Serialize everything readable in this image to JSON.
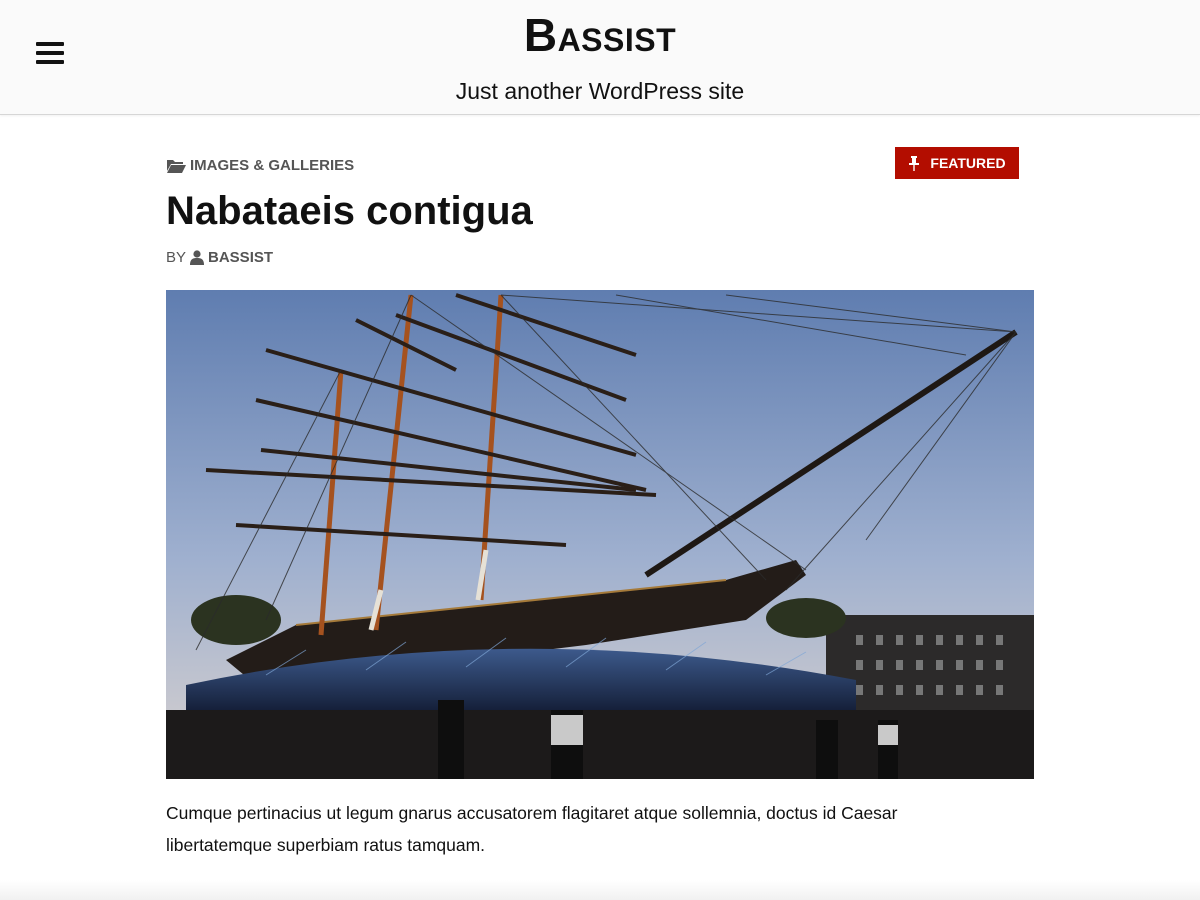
{
  "header": {
    "site_title": "Bassist",
    "site_description": "Just another WordPress site",
    "menu_icon": "hamburger-menu-icon"
  },
  "post": {
    "category": "Images & Galleries",
    "category_icon": "folder-open-icon",
    "featured_label": "Featured",
    "featured_icon": "pushpin-icon",
    "featured_color": "#b30d00",
    "title": "Nabataeis contigua",
    "byline_prefix": "By",
    "author_icon": "user-icon",
    "author": "Bassist",
    "image_subject": "tall ship photo",
    "excerpt": "Cumque pertinacius ut legum gnarus accusatorem flagitaret atque sollemnia, doctus id Caesar libertatemque superbiam ratus tamquam."
  }
}
